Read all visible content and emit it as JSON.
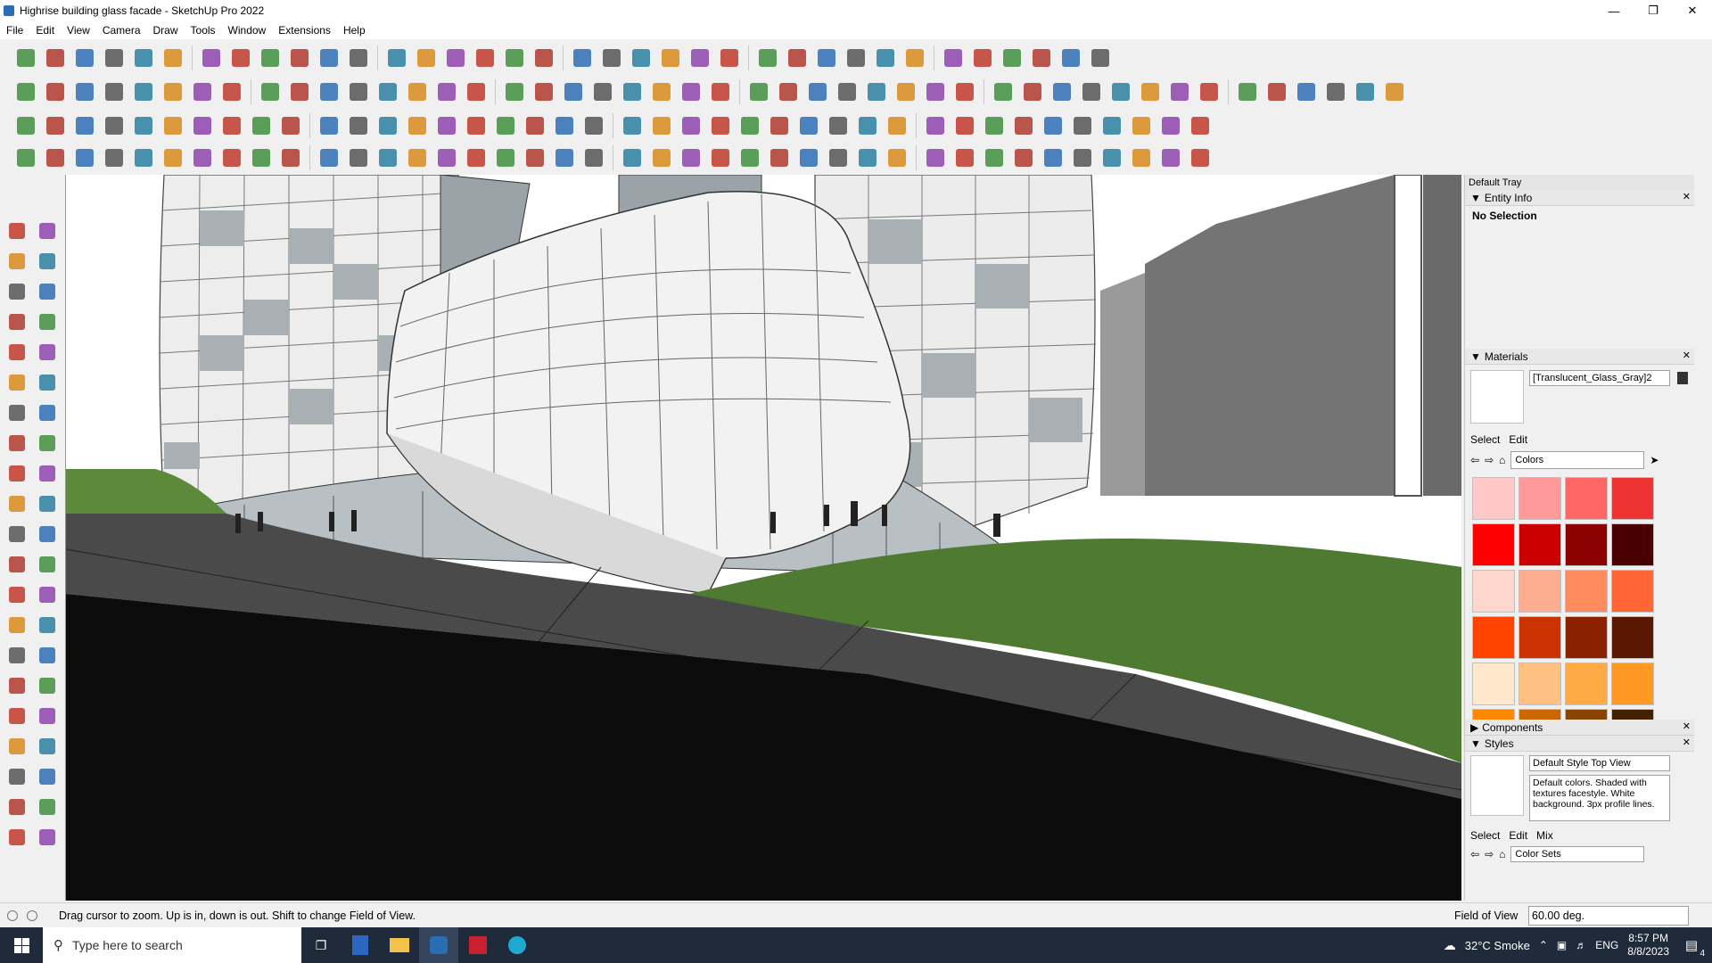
{
  "window": {
    "title": "Highrise building glass facade - SketchUp Pro 2022"
  },
  "menu": [
    "File",
    "Edit",
    "View",
    "Camera",
    "Draw",
    "Tools",
    "Window",
    "Extensions",
    "Help"
  ],
  "tray": {
    "title": "Default Tray",
    "entity_info": {
      "title": "Entity Info",
      "selection": "No Selection"
    },
    "materials": {
      "title": "Materials",
      "current": "[Translucent_Glass_Gray]2",
      "tabs": [
        "Select",
        "Edit"
      ],
      "library": "Colors",
      "swatches": [
        "#ffc8c8",
        "#ff9898",
        "#ff6666",
        "#ee3333",
        "#ff0000",
        "#cc0000",
        "#8b0000",
        "#4a0000",
        "#ffd6cc",
        "#ffad90",
        "#ff8a5c",
        "#ff6633",
        "#ff4400",
        "#cc3300",
        "#8a2000",
        "#5a1800",
        "#ffe8cc",
        "#ffc080",
        "#ffaa44",
        "#ff9922",
        "#ff8800",
        "#cc6600",
        "#884400",
        "#442200"
      ]
    },
    "components": {
      "title": "Components"
    },
    "styles": {
      "title": "Styles",
      "name": "Default Style Top View",
      "description": "Default colors.  Shaded with textures facestyle.  White background.  3px profile lines.",
      "tabs": [
        "Select",
        "Edit",
        "Mix"
      ],
      "library": "Color Sets"
    }
  },
  "status": {
    "hint": "Drag cursor to zoom.  Up is in, down is out. Shift to change Field of View.",
    "measure_label": "Field of View",
    "measure_value": "60.00 deg."
  },
  "taskbar": {
    "search_placeholder": "Type here to search",
    "weather": "32°C  Smoke",
    "lang": "ENG",
    "time": "8:57 PM",
    "date": "8/8/2023",
    "notifications": "4"
  },
  "colors": {
    "sky": "#ffffff",
    "grass": "#4f7a32",
    "ground": "#0c0c0c",
    "building": "#e8e8e8",
    "glass": "#9aa4aa"
  }
}
